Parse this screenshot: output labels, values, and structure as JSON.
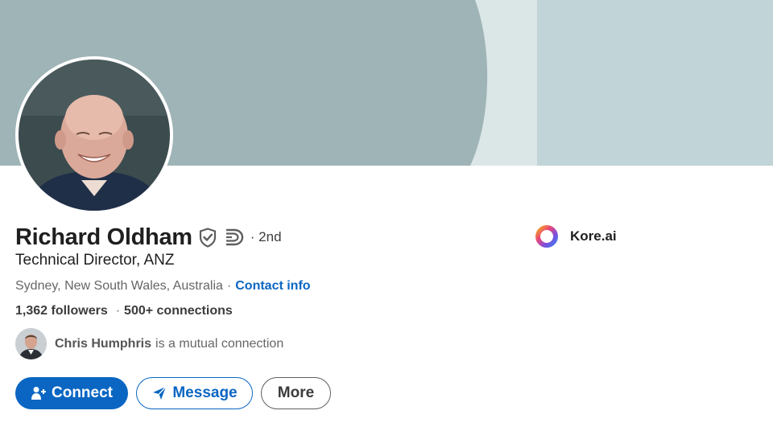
{
  "profile": {
    "name": "Richard Oldham",
    "degree": "· 2nd",
    "headline": "Technical Director, ANZ",
    "location": "Sydney, New South Wales, Australia",
    "separator": "·",
    "contact_info_label": "Contact info",
    "followers": "1,362 followers",
    "connections": "500+ connections",
    "mutual_name": "Chris Humphris",
    "mutual_text": "is a mutual connection"
  },
  "actions": {
    "connect_label": "Connect",
    "message_label": "Message",
    "more_label": "More"
  },
  "company": {
    "name": "Kore.ai"
  },
  "icons": {
    "verify": "shield-check-icon",
    "premium": "premium-badge-icon",
    "connect": "add-person-icon",
    "message": "send-icon",
    "company_logo": "kore-ai-logo"
  },
  "colors": {
    "accent": "#0a66c2",
    "banner_dark": "#9fb4b6",
    "banner_light": "#c1d4d7",
    "banner_mid": "#dbe6e7"
  }
}
